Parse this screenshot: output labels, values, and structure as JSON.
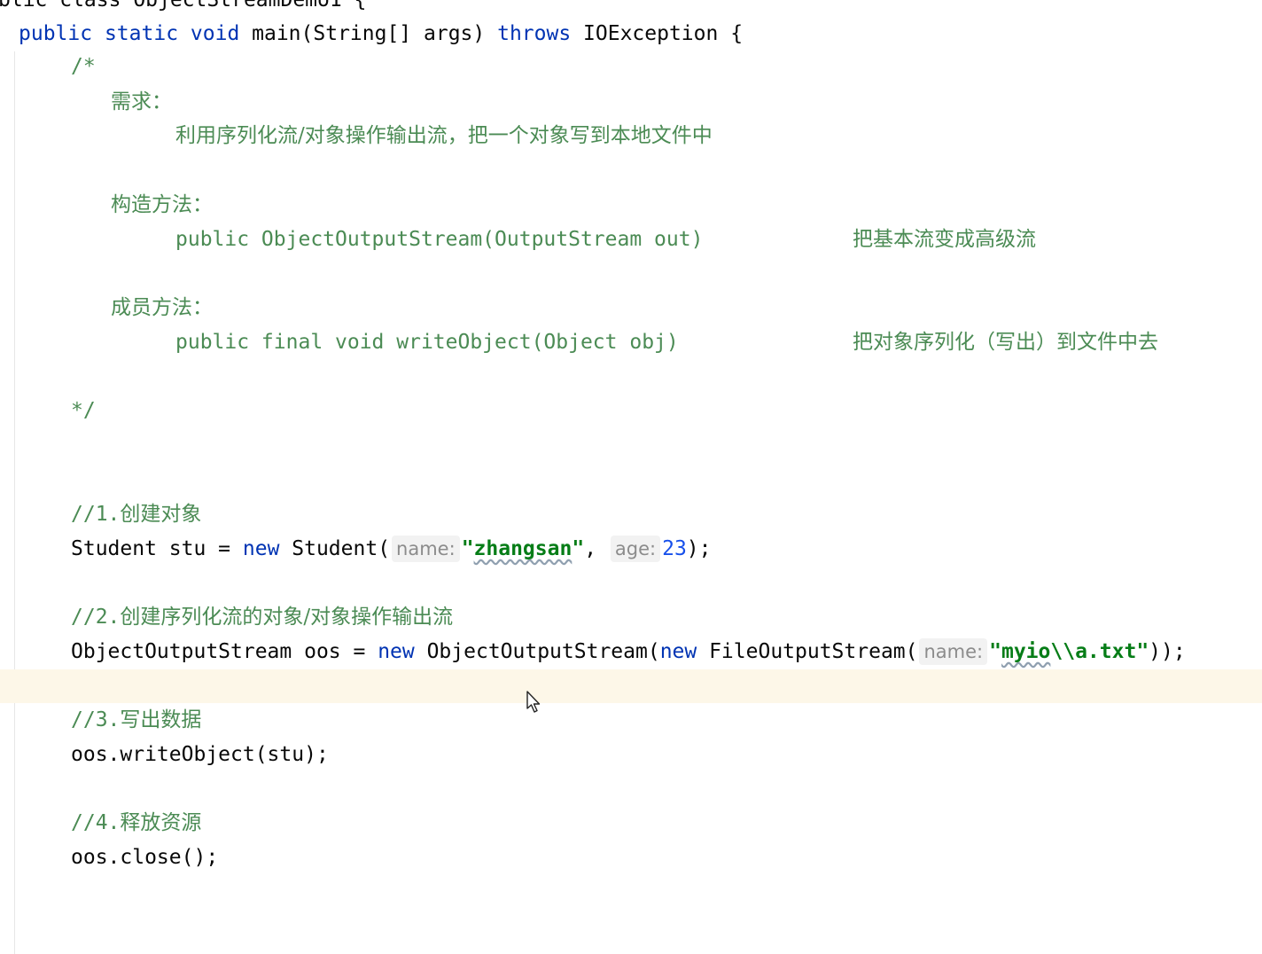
{
  "line_top_partial": "blic class ObjectStreamDemo1 {",
  "signature": {
    "public": "public",
    "static": "static",
    "void": "void",
    "rest": " main(String[] args) ",
    "throws": "throws",
    "tail": " IOException {"
  },
  "comment": {
    "open": "/*",
    "req_title": "需求：",
    "req_text": "利用序列化流/对象操作输出流，把一个对象写到本地文件中",
    "ctor_title": "构造方法：",
    "ctor_sig": "public ObjectOutputStream(OutputStream out)",
    "ctor_desc": "把基本流变成高级流",
    "member_title": "成员方法：",
    "member_sig": "public final void writeObject(Object obj)",
    "member_desc": "把对象序列化（写出）到文件中去",
    "close": "*/"
  },
  "step1": {
    "comment_prefix": "//1.",
    "comment_text": "创建对象",
    "type": "Student stu = ",
    "new": "new",
    "call": " Student(",
    "hint_name": "name:",
    "str_q1": "\"",
    "str_val": "zhangsan",
    "str_q2": "\"",
    "comma": ", ",
    "hint_age": "age:",
    "num": "23",
    "end": ");"
  },
  "step2": {
    "comment_prefix": "//2.",
    "comment_text": "创建序列化流的对象/对象操作输出流",
    "type": "ObjectOutputStream oos = ",
    "new1": "new",
    "call1": " ObjectOutputStream(",
    "new2": "new",
    "call2": " FileOutputStream(",
    "hint_name": "name:",
    "str_q1": "\"",
    "str_typo": "myio",
    "str_rest": "\\\\a.txt",
    "str_q2": "\"",
    "end": "));"
  },
  "step3": {
    "comment_prefix": "//3.",
    "comment_text": "写出数据",
    "code": "oos.writeObject(stu);"
  },
  "step4": {
    "comment_prefix": "//4.",
    "comment_text": "释放资源",
    "code": "oos.close();"
  },
  "colors": {
    "keyword": "#0033b3",
    "comment": "#4b8b54",
    "string": "#067d17",
    "number": "#1750eb",
    "current_line": "#fdf7e8"
  }
}
